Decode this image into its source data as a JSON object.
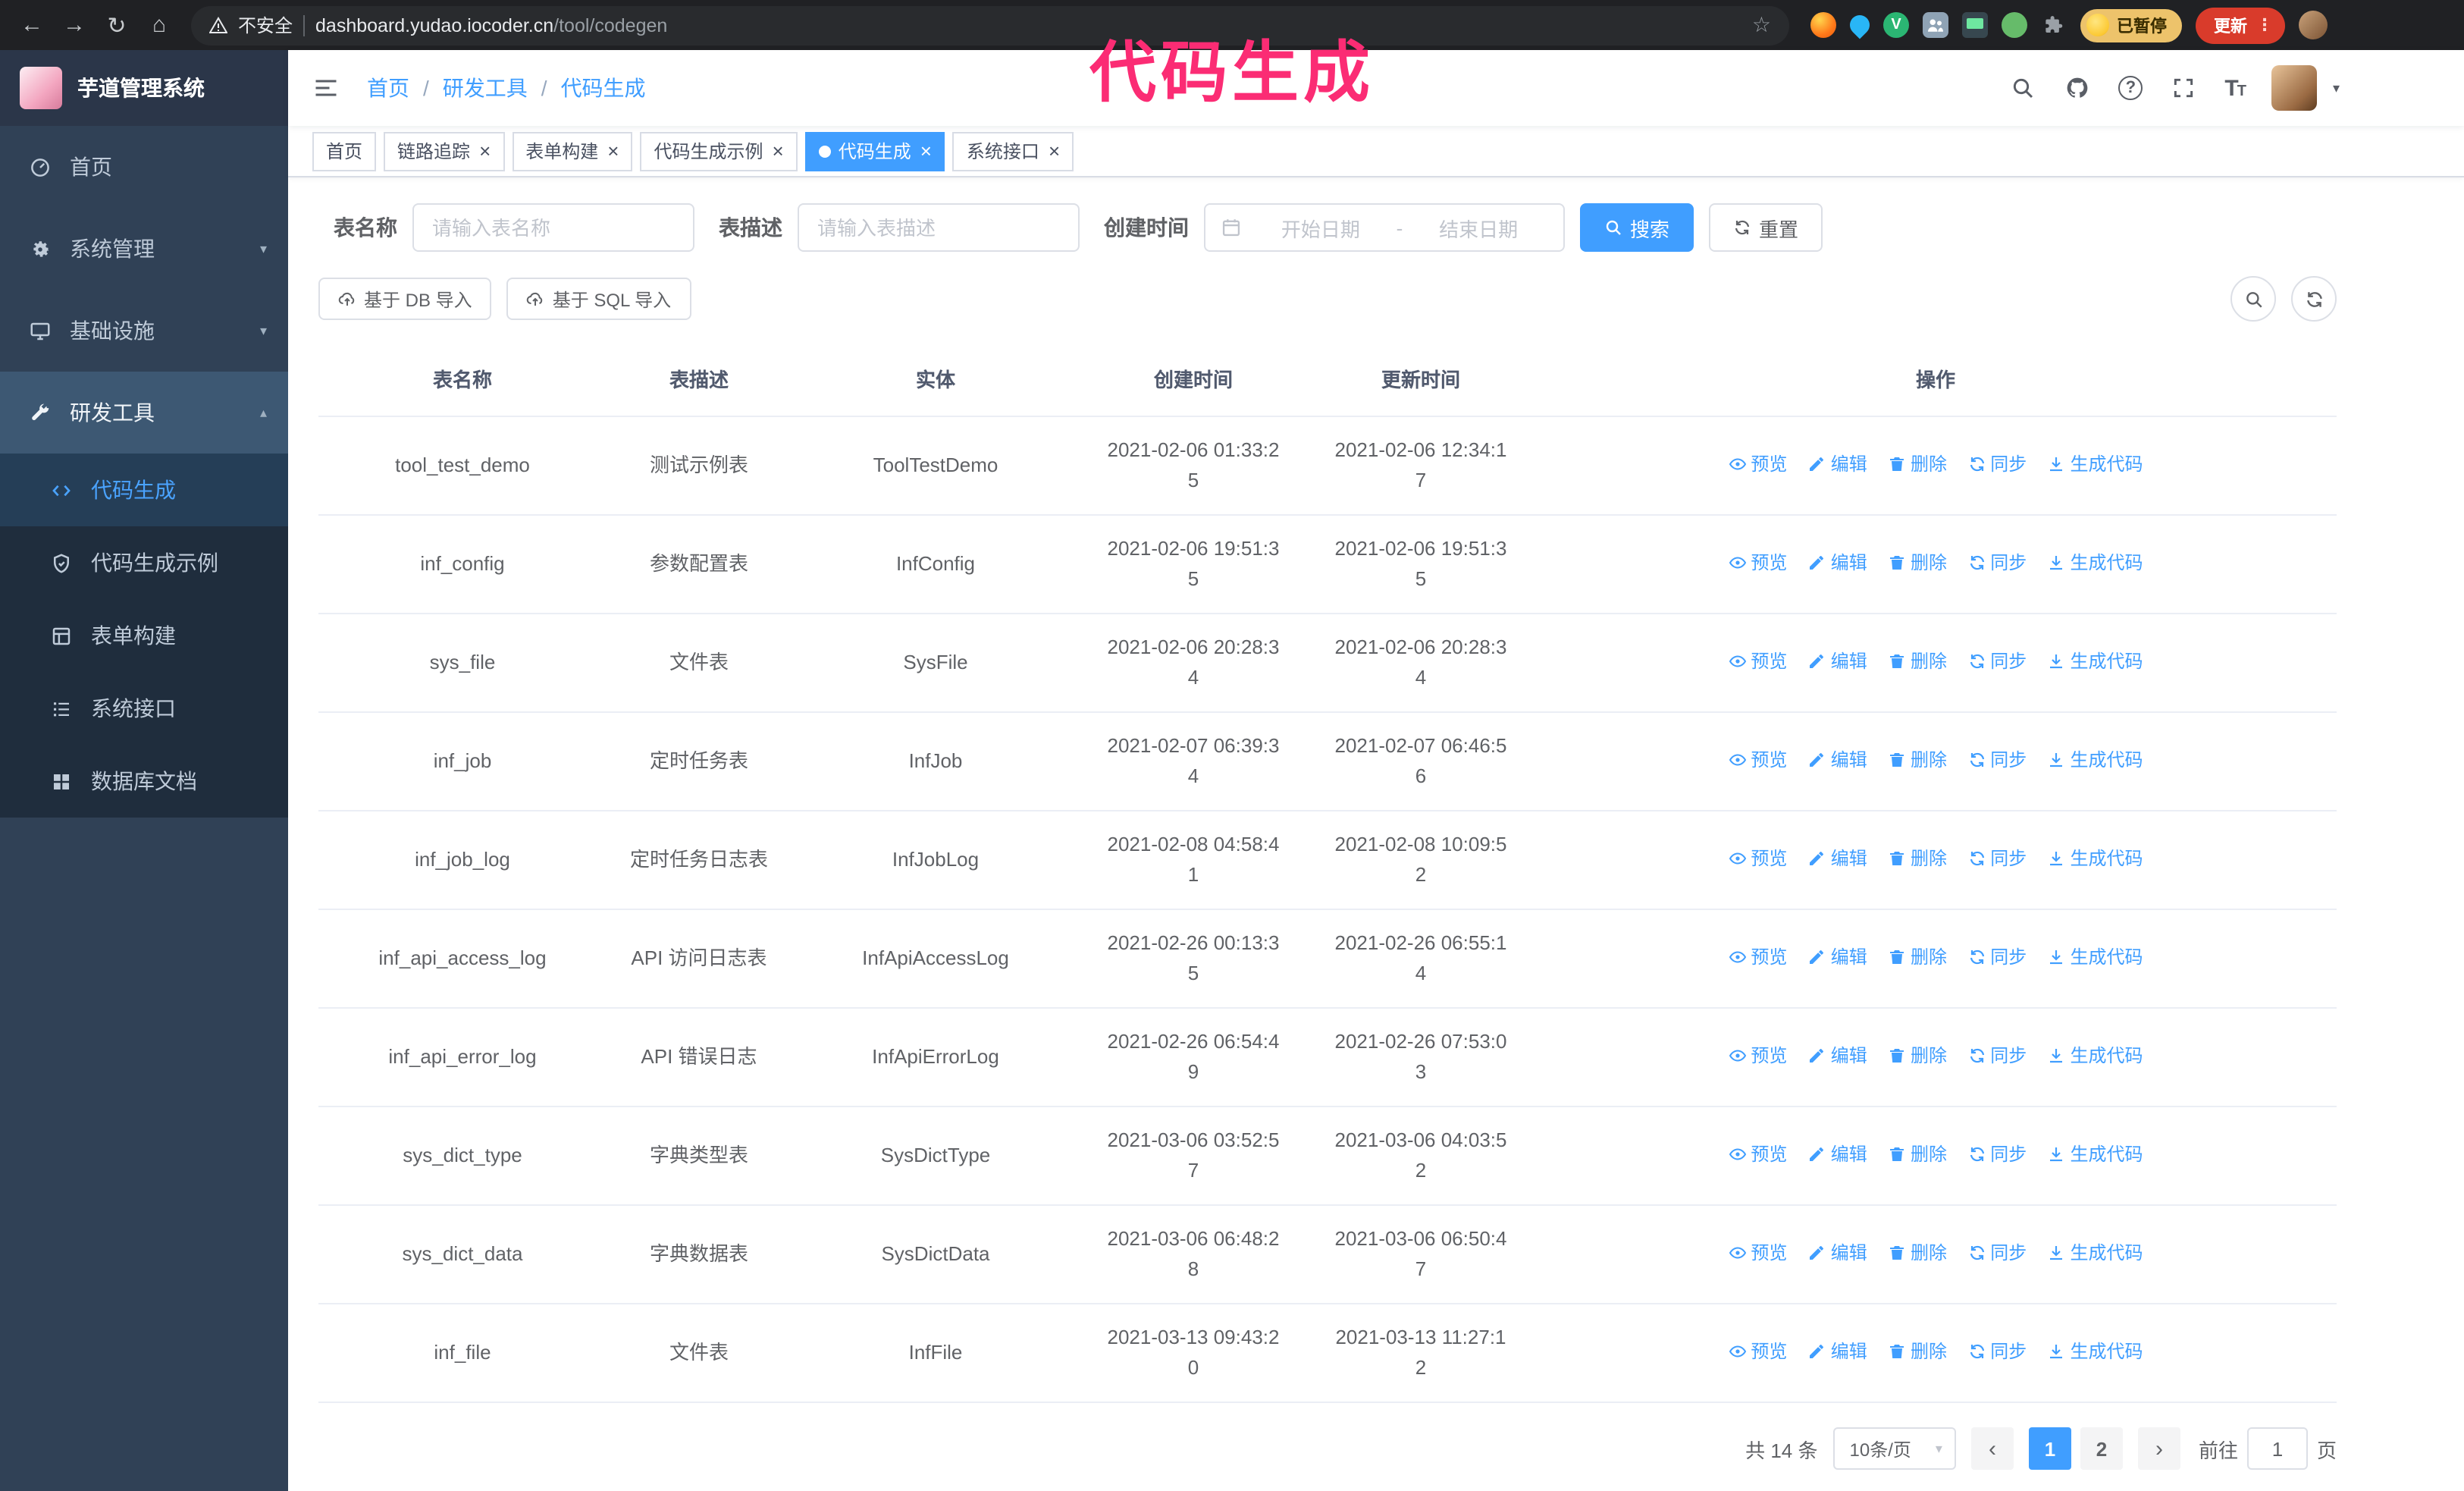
{
  "annotation": {
    "text": "代码生成"
  },
  "browser": {
    "security_label": "不安全",
    "url_domain": "dashboard.yudao.iocoder.cn",
    "url_path": "/tool/codegen",
    "paused_badge": "已暂停",
    "update_button": "更新",
    "vue_devtools_glyph": "V"
  },
  "sidebar": {
    "app_title": "芋道管理系统",
    "items": [
      {
        "label": "首页",
        "icon": "dashboard-icon"
      },
      {
        "label": "系统管理",
        "icon": "gear-icon",
        "arrow": "down"
      },
      {
        "label": "基础设施",
        "icon": "infrastructure-icon",
        "arrow": "down"
      },
      {
        "label": "研发工具",
        "icon": "tools-icon",
        "arrow": "up",
        "expanded": true
      }
    ],
    "subitems": [
      {
        "label": "代码生成",
        "icon": "code-icon",
        "active": true
      },
      {
        "label": "代码生成示例",
        "icon": "example-badge-icon",
        "active": false
      },
      {
        "label": "表单构建",
        "icon": "form-builder-icon",
        "active": false
      },
      {
        "label": "系统接口",
        "icon": "api-list-icon",
        "active": false
      },
      {
        "label": "数据库文档",
        "icon": "database-doc-icon",
        "active": false
      }
    ]
  },
  "header": {
    "breadcrumb": [
      "首页",
      "研发工具",
      "代码生成"
    ]
  },
  "tabs": [
    {
      "label": "首页",
      "closable": false,
      "active": false
    },
    {
      "label": "链路追踪",
      "closable": true,
      "active": false
    },
    {
      "label": "表单构建",
      "closable": true,
      "active": false
    },
    {
      "label": "代码生成示例",
      "closable": true,
      "active": false
    },
    {
      "label": "代码生成",
      "closable": true,
      "active": true
    },
    {
      "label": "系统接口",
      "closable": true,
      "active": false
    }
  ],
  "filters": {
    "table_name_label": "表名称",
    "table_name_placeholder": "请输入表名称",
    "table_desc_label": "表描述",
    "table_desc_placeholder": "请输入表描述",
    "create_time_label": "创建时间",
    "date_start_placeholder": "开始日期",
    "date_separator": "-",
    "date_end_placeholder": "结束日期",
    "search_label": "搜索",
    "reset_label": "重置"
  },
  "toolbar": {
    "import_db": "基于 DB 导入",
    "import_sql": "基于 SQL 导入"
  },
  "table": {
    "columns": [
      "表名称",
      "表描述",
      "实体",
      "创建时间",
      "更新时间",
      "操作"
    ],
    "op_labels": [
      "预览",
      "编辑",
      "删除",
      "同步",
      "生成代码"
    ],
    "rows": [
      {
        "name": "tool_test_demo",
        "desc": "测试示例表",
        "entity": "ToolTestDemo",
        "created": "2021-02-06 01:33:25",
        "updated": "2021-02-06 12:34:17"
      },
      {
        "name": "inf_config",
        "desc": "参数配置表",
        "entity": "InfConfig",
        "created": "2021-02-06 19:51:35",
        "updated": "2021-02-06 19:51:35"
      },
      {
        "name": "sys_file",
        "desc": "文件表",
        "entity": "SysFile",
        "created": "2021-02-06 20:28:34",
        "updated": "2021-02-06 20:28:34"
      },
      {
        "name": "inf_job",
        "desc": "定时任务表",
        "entity": "InfJob",
        "created": "2021-02-07 06:39:34",
        "updated": "2021-02-07 06:46:56"
      },
      {
        "name": "inf_job_log",
        "desc": "定时任务日志表",
        "entity": "InfJobLog",
        "created": "2021-02-08 04:58:41",
        "updated": "2021-02-08 10:09:52"
      },
      {
        "name": "inf_api_access_log",
        "desc": "API 访问日志表",
        "entity": "InfApiAccessLog",
        "created": "2021-02-26 00:13:35",
        "updated": "2021-02-26 06:55:14"
      },
      {
        "name": "inf_api_error_log",
        "desc": "API 错误日志",
        "entity": "InfApiErrorLog",
        "created": "2021-02-26 06:54:49",
        "updated": "2021-02-26 07:53:03"
      },
      {
        "name": "sys_dict_type",
        "desc": "字典类型表",
        "entity": "SysDictType",
        "created": "2021-03-06 03:52:57",
        "updated": "2021-03-06 04:03:52"
      },
      {
        "name": "sys_dict_data",
        "desc": "字典数据表",
        "entity": "SysDictData",
        "created": "2021-03-06 06:48:28",
        "updated": "2021-03-06 06:50:47"
      },
      {
        "name": "inf_file",
        "desc": "文件表",
        "entity": "InfFile",
        "created": "2021-03-13 09:43:20",
        "updated": "2021-03-13 11:27:12"
      }
    ]
  },
  "pagination": {
    "total": "共 14 条",
    "page_size": "10条/页",
    "pages": [
      "1",
      "2"
    ],
    "active_page": "1",
    "prev_glyph": "‹",
    "next_glyph": "›",
    "goto_prefix": "前往",
    "goto_value": "1",
    "goto_suffix": "页"
  }
}
